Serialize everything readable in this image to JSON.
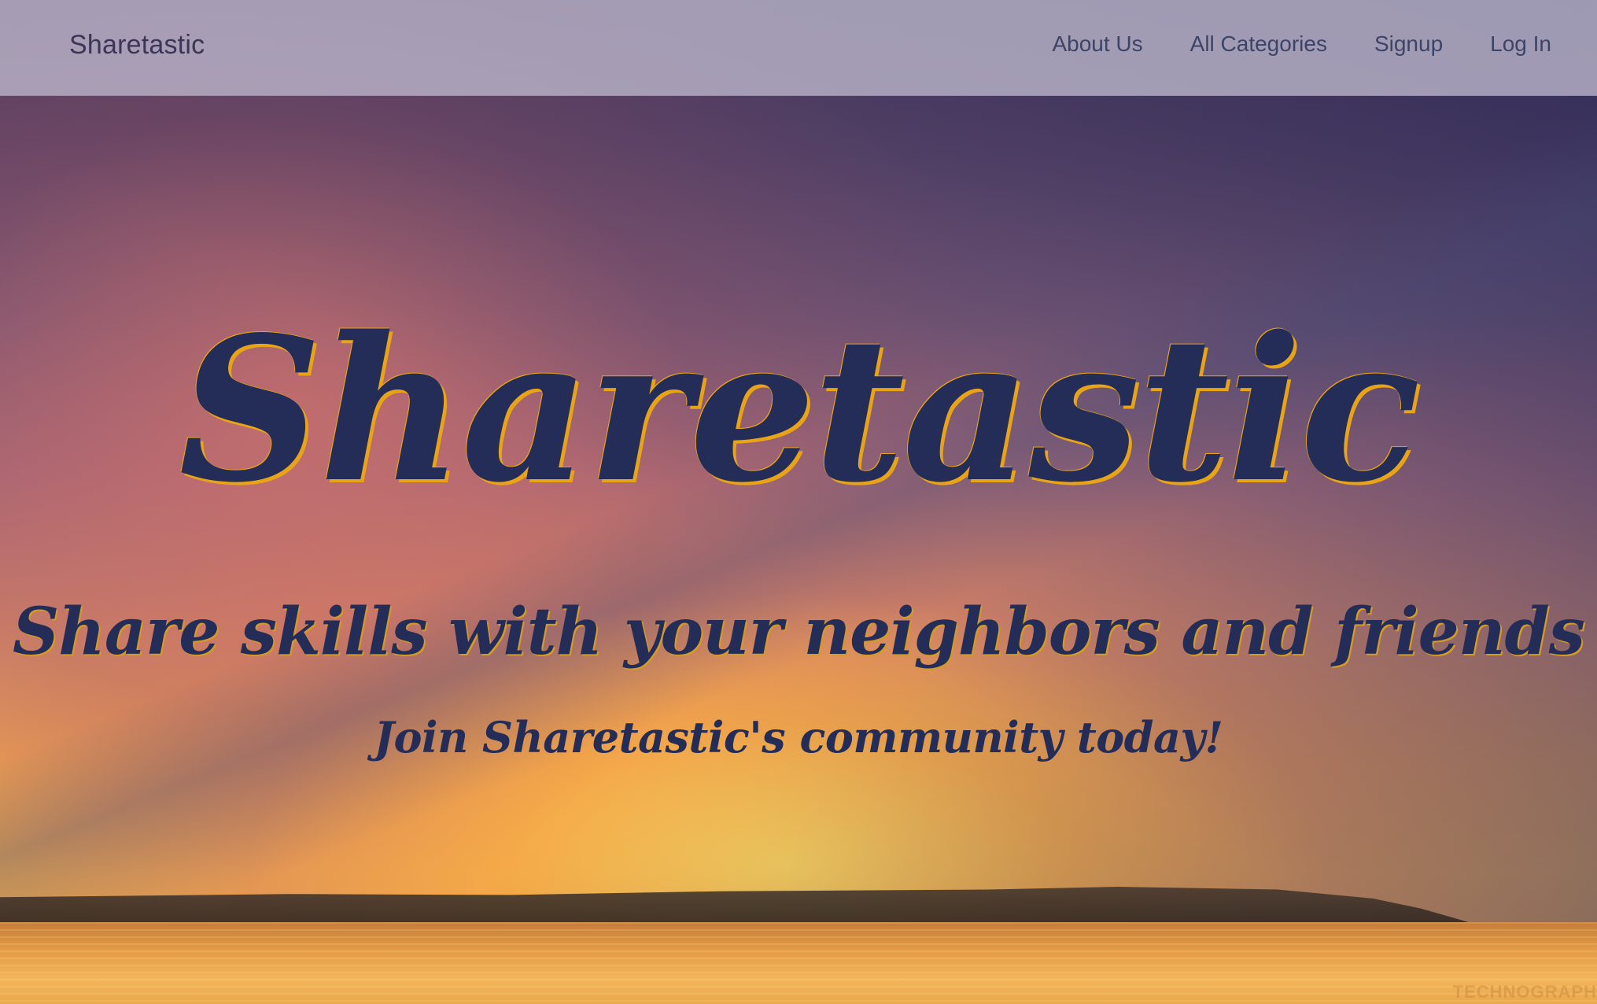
{
  "navbar": {
    "brand": "Sharetastic",
    "links": [
      {
        "label": "About Us"
      },
      {
        "label": "All Categories"
      },
      {
        "label": "Signup"
      },
      {
        "label": "Log In"
      }
    ]
  },
  "hero": {
    "title": "Sharetastic",
    "subtitle": "Share skills with your neighbors and friends",
    "cta": "Join Sharetastic's community today!",
    "background": "sunset-over-water-photo",
    "watermark": "TECHNOGRAPH"
  },
  "colors": {
    "title_text": "#232d58",
    "title_outline": "#e8a416",
    "navbar_bg": "#beb9cd",
    "nav_text": "#3d4468"
  }
}
